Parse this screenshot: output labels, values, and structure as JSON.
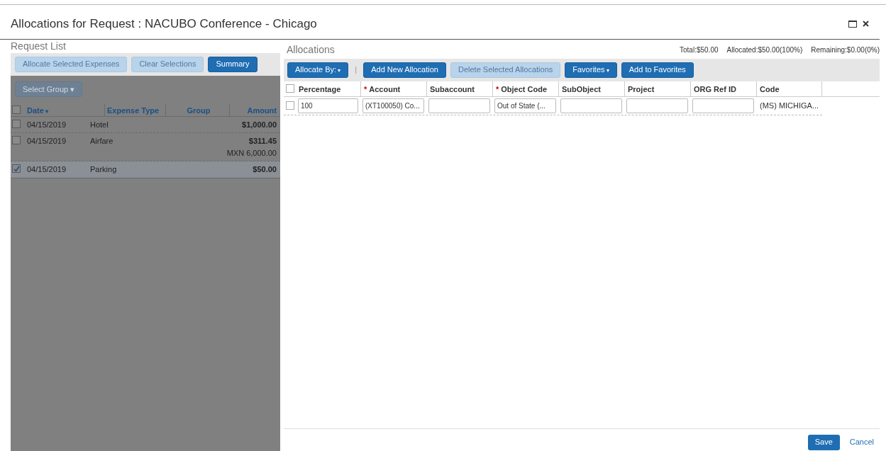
{
  "window": {
    "title": "Allocations for Request : NACUBO Conference - Chicago"
  },
  "request_list": {
    "title": "Request List",
    "buttons": [
      {
        "label": "Allocate Selected Expenses",
        "disabled": true
      },
      {
        "label": "Clear Selections",
        "disabled": true
      },
      {
        "label": "Summary",
        "disabled": false
      }
    ],
    "group_button": {
      "label": "Select Group",
      "caret": "▾",
      "disabled": true
    },
    "select_all_checked": false,
    "columns": [
      {
        "label": "Date",
        "sort_icon": "▾"
      },
      {
        "label": "Expense Type"
      },
      {
        "label": "Group"
      },
      {
        "label": "Amount"
      }
    ],
    "rows": [
      {
        "checked": false,
        "date": "04/15/2019",
        "type": "Hotel",
        "amount": "$1,000.00"
      },
      {
        "checked": false,
        "date": "04/15/2019",
        "type": "Airfare",
        "amount": "$311.45",
        "original_amount": "MXN 6,000.00"
      },
      {
        "checked": true,
        "date": "04/15/2019",
        "type": "Parking",
        "amount": "$50.00"
      }
    ]
  },
  "allocations": {
    "title": "Allocations",
    "totals": [
      "Total:$50.00",
      "Allocated:$50.00(100%)",
      "Remaining:$0.00(0%)"
    ],
    "toolbar": [
      {
        "label": "Allocate By:",
        "caret": "▾",
        "disabled": false
      },
      {
        "kind": "separator",
        "label": "|"
      },
      {
        "label": "Add New Allocation",
        "disabled": false
      },
      {
        "label": "Delete Selected Allocations",
        "disabled": true
      },
      {
        "label": "Favorites",
        "caret": "▾",
        "disabled": false
      },
      {
        "label": "Add to Favorites",
        "disabled": false
      }
    ],
    "select_all_checked": false,
    "columns": [
      {
        "label": "Percentage"
      },
      {
        "label": "Account",
        "required_mark": "*"
      },
      {
        "label": "Subaccount"
      },
      {
        "label": "Object Code",
        "required_mark": "*"
      },
      {
        "label": "SubObject"
      },
      {
        "label": "Project"
      },
      {
        "label": "ORG Ref ID"
      },
      {
        "label": "Code"
      }
    ],
    "rows": [
      {
        "checked": false,
        "cells": [
          {
            "kind": "input",
            "value": "100"
          },
          {
            "kind": "input",
            "value": "(XT100050) Co..."
          },
          {
            "kind": "input"
          },
          {
            "kind": "input",
            "value": "Out of State (..."
          },
          {
            "kind": "input"
          },
          {
            "kind": "input"
          },
          {
            "kind": "input"
          },
          {
            "kind": "text",
            "value": "(MS) MICHIGA..."
          }
        ]
      }
    ]
  },
  "footer": {
    "save": "Save",
    "cancel": "Cancel"
  }
}
